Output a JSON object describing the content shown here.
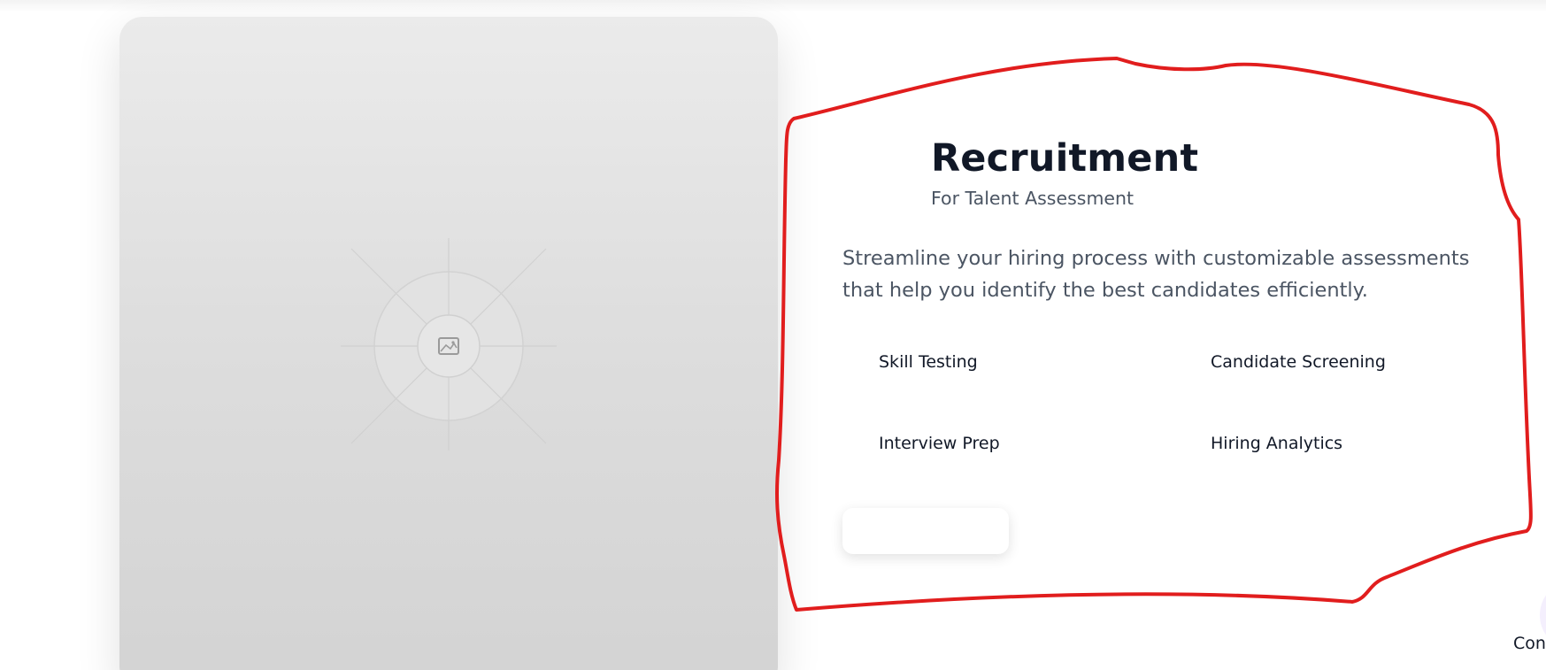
{
  "image_card": {
    "icon": "image-placeholder-icon"
  },
  "section": {
    "title": "Recruitment",
    "subtitle": "For Talent Assessment",
    "description": "Streamline your hiring process with customizable assessments that help you identify the best candidates efficiently.",
    "features": [
      {
        "label": "Skill Testing"
      },
      {
        "label": "Candidate Screening"
      },
      {
        "label": "Interview Prep"
      },
      {
        "label": "Hiring Analytics"
      }
    ],
    "cta_label": ""
  },
  "annotation": {
    "color": "#e11d1d"
  },
  "corner": {
    "label": "Con"
  }
}
